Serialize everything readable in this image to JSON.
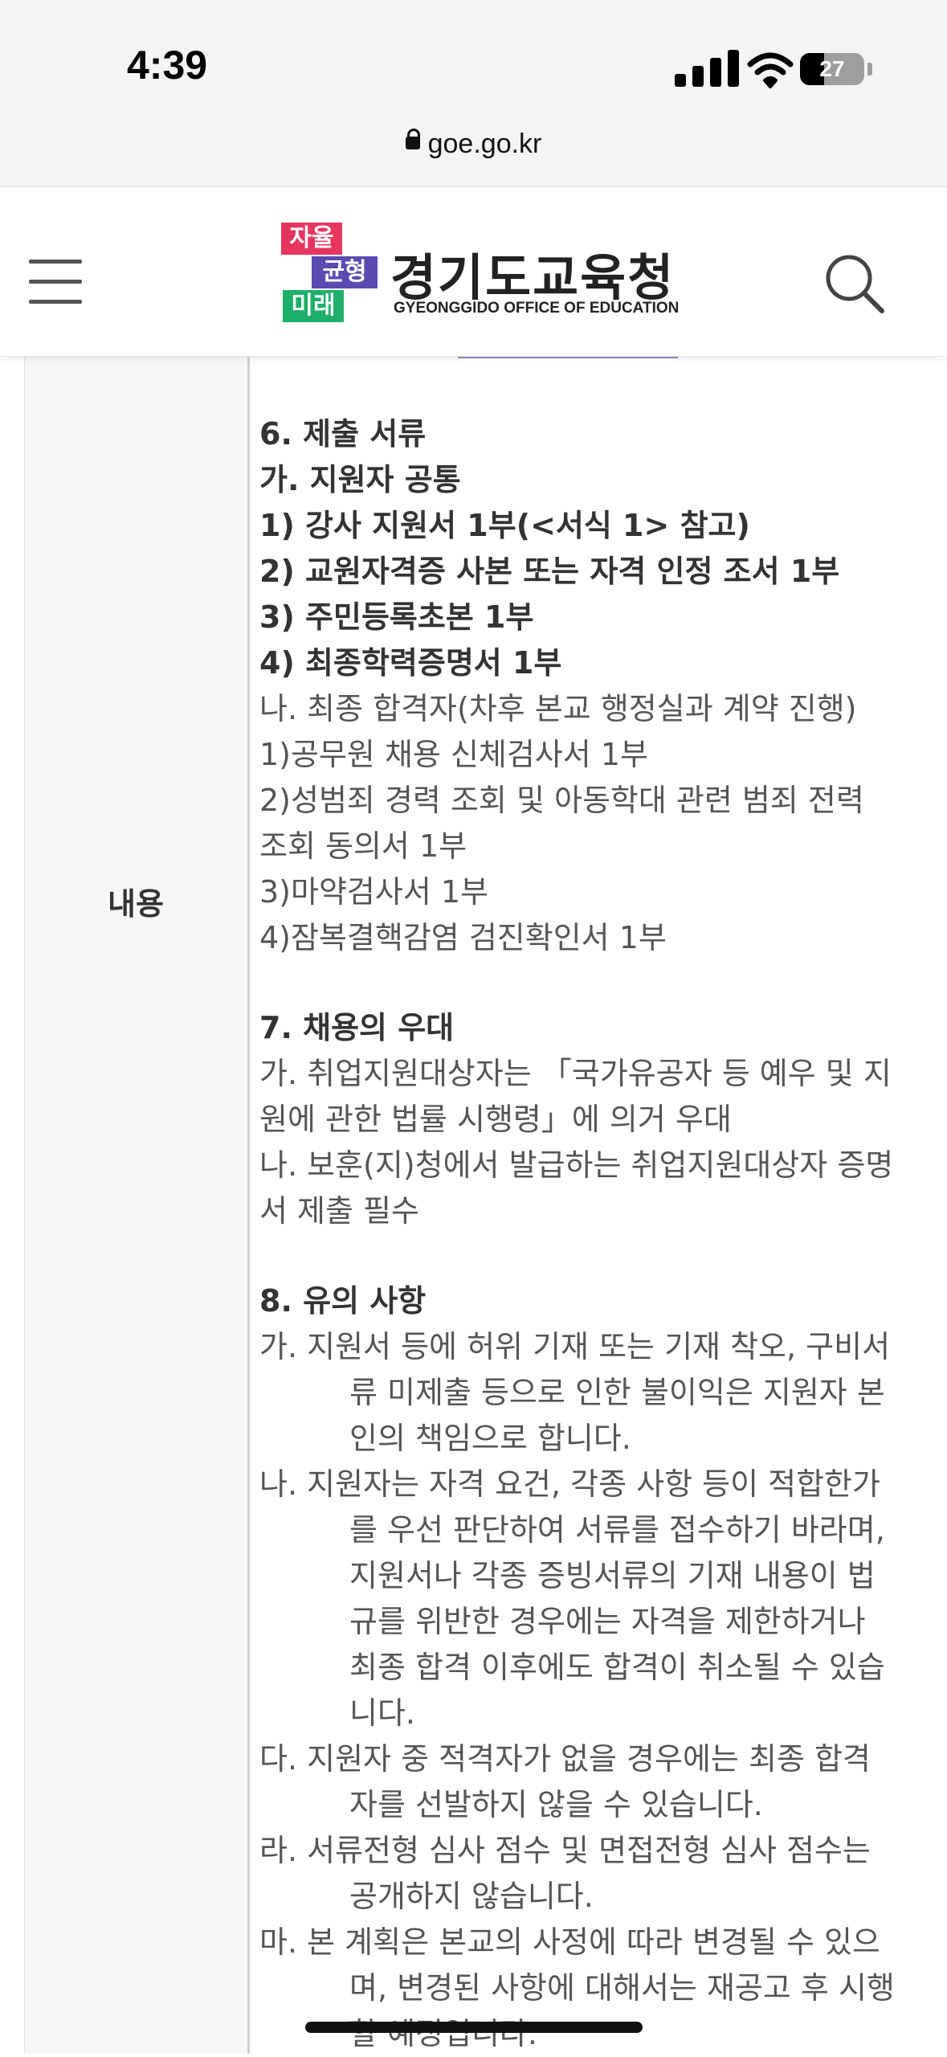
{
  "status_bar": {
    "time": "4:39",
    "battery": "27",
    "url": "goe.go.kr",
    "icons": [
      "signal-icon",
      "wifi-icon",
      "battery-icon",
      "lock-icon"
    ]
  },
  "header": {
    "badge": [
      "자율",
      "균형",
      "미래"
    ],
    "title": "경기도교육청",
    "subtitle": "GYEONGGIDO OFFICE OF EDUCATION",
    "badge_colors": [
      "#e6365f",
      "#5a4bb0",
      "#1eb06a"
    ],
    "icons": [
      "menu-icon",
      "search-icon"
    ]
  },
  "row_label": "내용",
  "content_lines": [
    {
      "text": "6. 제출 서류",
      "style": "bold"
    },
    {
      "text": "가. 지원자 공통",
      "style": "bold"
    },
    {
      "text": "1) 강사 지원서 1부(<서식 1> 참고)",
      "style": "bold"
    },
    {
      "text": "2) 교원자격증 사본 또는 자격 인정 조서 1부",
      "style": "bold"
    },
    {
      "text": "3) 주민등록초본 1부",
      "style": "bold"
    },
    {
      "text": "4) 최종학력증명서 1부",
      "style": "bold"
    },
    {
      "text": "나. 최종 합격자(차후 본교 행정실과 계약 진행)",
      "style": "normal"
    },
    {
      "text": "1)공무원 채용 신체검사서 1부",
      "style": "normal"
    },
    {
      "text": "2)성범죄 경력 조회 및 아동학대 관련 범죄 전력",
      "style": "normal"
    },
    {
      "text": "조회 동의서 1부",
      "style": "normal"
    },
    {
      "text": "3)마약검사서 1부",
      "style": "normal"
    },
    {
      "text": "4)잠복결핵감염 검진확인서 1부",
      "style": "normal"
    },
    {
      "text": "",
      "style": "gap"
    },
    {
      "text": "7. 채용의 우대",
      "style": "bold"
    },
    {
      "text": "가. 취업지원대상자는 「국가유공자 등 예우 및 지",
      "style": "normal"
    },
    {
      "text": "원에 관한 법률 시행령」에 의거 우대",
      "style": "normal"
    },
    {
      "text": "나. 보훈(지)청에서 발급하는 취업지원대상자 증명",
      "style": "normal"
    },
    {
      "text": "서 제출 필수",
      "style": "normal"
    },
    {
      "text": "",
      "style": "gap"
    },
    {
      "text": "8. 유의 사항",
      "style": "bold"
    },
    {
      "text": "가. 지원서 등에 허위 기재 또는 기재 착오, 구비서",
      "style": "normal"
    },
    {
      "text": "류 미제출 등으로 인한 불이익은 지원자 본",
      "style": "indent"
    },
    {
      "text": "인의 책임으로 합니다.",
      "style": "indent"
    },
    {
      "text": "나. 지원자는 자격 요건, 각종 사항 등이 적합한가",
      "style": "normal"
    },
    {
      "text": "를 우선 판단하여 서류를 접수하기 바라며,",
      "style": "indent"
    },
    {
      "text": "지원서나 각종 증빙서류의 기재 내용이 법",
      "style": "indent"
    },
    {
      "text": "규를 위반한 경우에는 자격을 제한하거나",
      "style": "indent"
    },
    {
      "text": "최종 합격 이후에도 합격이 취소될 수 있습",
      "style": "indent"
    },
    {
      "text": "니다.",
      "style": "indent"
    },
    {
      "text": "다. 지원자 중 적격자가 없을 경우에는 최종 합격",
      "style": "normal"
    },
    {
      "text": "자를 선발하지 않을 수 있습니다.",
      "style": "indent"
    },
    {
      "text": "라. 서류전형 심사 점수 및 면접전형 심사 점수는",
      "style": "normal"
    },
    {
      "text": "공개하지 않습니다.",
      "style": "indent"
    },
    {
      "text": "마. 본 계획은 본교의 사정에 따라 변경될 수 있으",
      "style": "normal"
    },
    {
      "text": "며, 변경된 사항에 대해서는 재공고 후 시행",
      "style": "indent"
    },
    {
      "text": "할 예정입니다.",
      "style": "indent"
    }
  ]
}
